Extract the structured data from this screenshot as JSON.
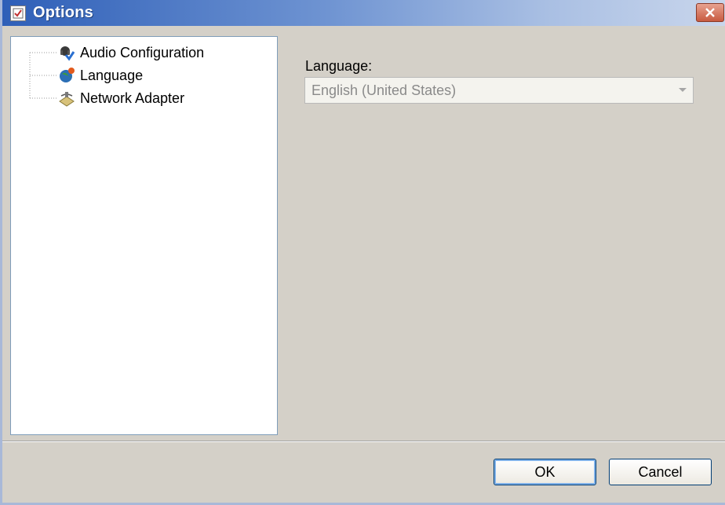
{
  "window": {
    "title": "Options"
  },
  "tree": {
    "items": [
      {
        "label": "Audio Configuration",
        "icon": "audio-configuration-icon"
      },
      {
        "label": "Language",
        "icon": "language-globe-icon"
      },
      {
        "label": "Network Adapter",
        "icon": "network-adapter-icon"
      }
    ]
  },
  "language_panel": {
    "label": "Language:",
    "selected_value": "English (United States)"
  },
  "buttons": {
    "ok_label": "OK",
    "cancel_label": "Cancel"
  },
  "colors": {
    "titlebar_start": "#2e5fb8",
    "titlebar_end": "#c9d6ec",
    "close_button": "#c85a40",
    "dialog_background": "#d4d0c8"
  }
}
